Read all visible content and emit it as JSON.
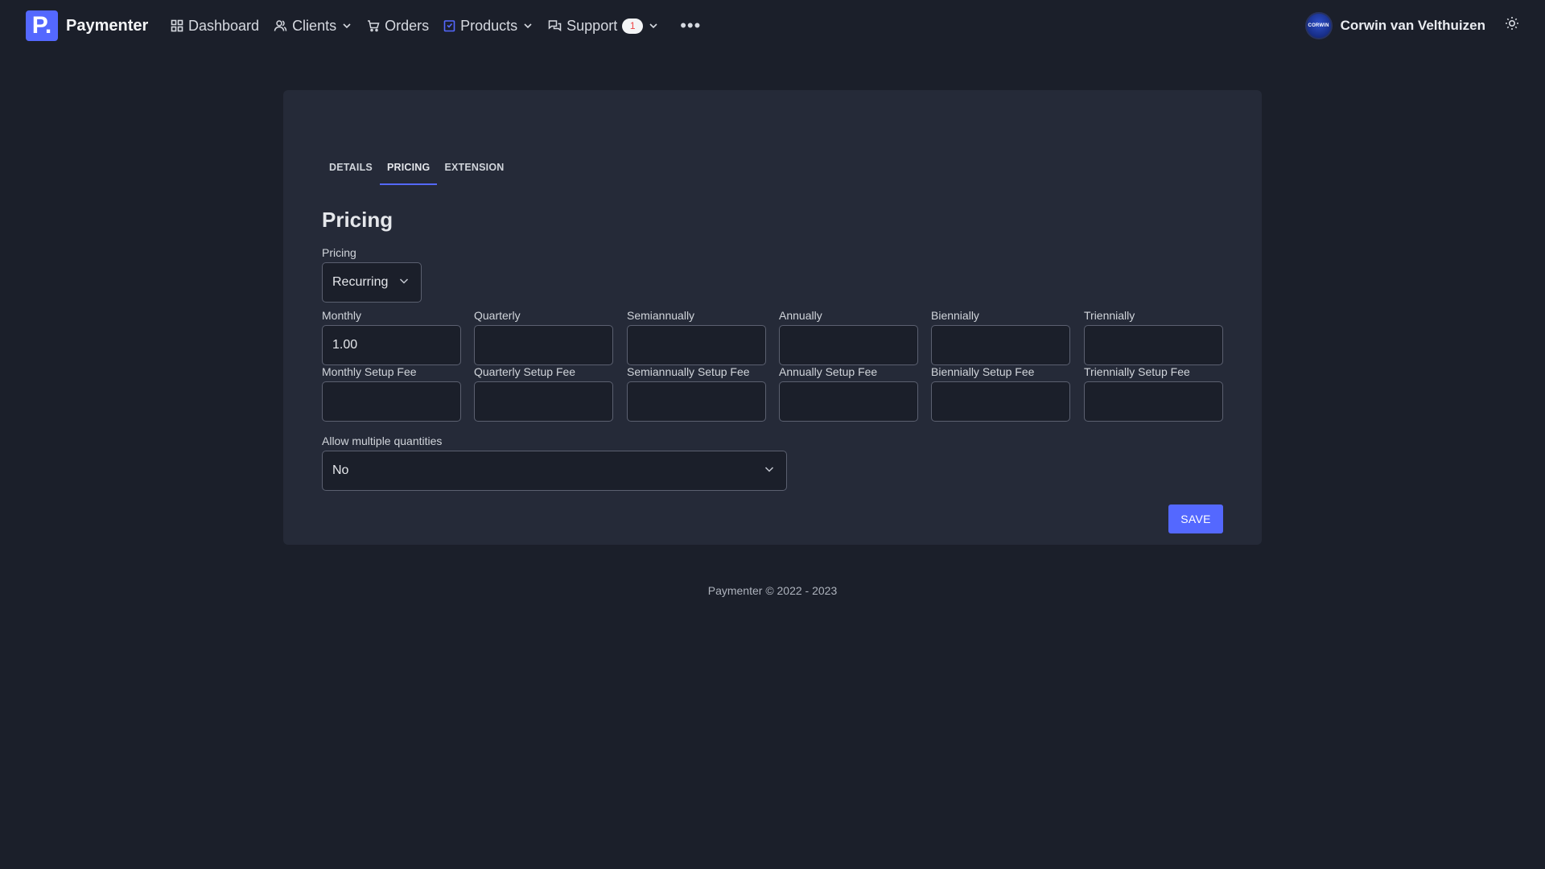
{
  "brand": {
    "logo_letter": "P.",
    "name": "Paymenter"
  },
  "nav": {
    "items": [
      {
        "id": "dashboard",
        "label": "Dashboard",
        "icon": "grid-icon",
        "dropdown": false
      },
      {
        "id": "clients",
        "label": "Clients",
        "icon": "users-icon",
        "dropdown": true
      },
      {
        "id": "orders",
        "label": "Orders",
        "icon": "cart-icon",
        "dropdown": false
      },
      {
        "id": "products",
        "label": "Products",
        "icon": "box-icon",
        "dropdown": true,
        "active": true
      },
      {
        "id": "support",
        "label": "Support",
        "icon": "chat-icon",
        "dropdown": true,
        "badge": "1"
      }
    ],
    "more_label": "•••"
  },
  "user": {
    "name": "Corwin van Velthuizen",
    "avatar_text": "CORWIN"
  },
  "theme_toggle_icon": "sun-icon",
  "tabs": [
    {
      "label": "DETAILS",
      "active": false
    },
    {
      "label": "PRICING",
      "active": true
    },
    {
      "label": "EXTENSION",
      "active": false
    }
  ],
  "section_title": "Pricing",
  "pricing_type": {
    "label": "Pricing",
    "value": "Recurring"
  },
  "prices": [
    {
      "label": "Monthly",
      "value": "1.00"
    },
    {
      "label": "Quarterly",
      "value": ""
    },
    {
      "label": "Semiannually",
      "value": ""
    },
    {
      "label": "Annually",
      "value": ""
    },
    {
      "label": "Biennially",
      "value": ""
    },
    {
      "label": "Triennially",
      "value": ""
    }
  ],
  "setup_fees": [
    {
      "label": "Monthly Setup Fee",
      "value": ""
    },
    {
      "label": "Quarterly Setup Fee",
      "value": ""
    },
    {
      "label": "Semiannually Setup Fee",
      "value": ""
    },
    {
      "label": "Annually Setup Fee",
      "value": ""
    },
    {
      "label": "Biennially Setup Fee",
      "value": ""
    },
    {
      "label": "Triennially Setup Fee",
      "value": ""
    }
  ],
  "allow_quantities": {
    "label": "Allow multiple quantities",
    "value": "No"
  },
  "save_label": "SAVE",
  "footer": "Paymenter © 2022 - 2023",
  "colors": {
    "accent": "#5468ff",
    "background": "#1b1f2a",
    "card": "#252a38",
    "badge_text": "#ef4444"
  }
}
